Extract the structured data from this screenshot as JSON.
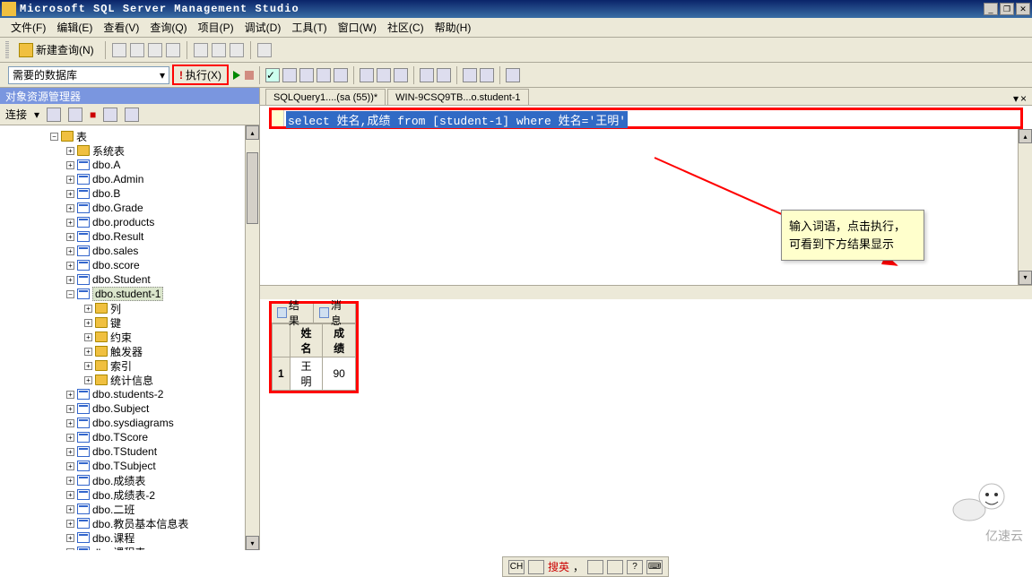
{
  "app_title": "Microsoft SQL Server Management Studio",
  "menu": {
    "file": "文件(F)",
    "edit": "编辑(E)",
    "view": "查看(V)",
    "query": "查询(Q)",
    "project": "项目(P)",
    "debug": "调试(D)",
    "tools": "工具(T)",
    "window": "窗口(W)",
    "community": "社区(C)",
    "help": "帮助(H)"
  },
  "toolbar": {
    "new_query": "新建查询(N)",
    "db_selector": "需要的数据库",
    "execute": "执行(X)"
  },
  "object_explorer": {
    "title": "对象资源管理器",
    "connect": "连接"
  },
  "tree": {
    "tables_folder": "表",
    "system_tables": "系统表",
    "cols": "列",
    "keys": "键",
    "constraints": "约束",
    "triggers": "触发器",
    "indexes": "索引",
    "stats": "统计信息",
    "tables": [
      "dbo.A",
      "dbo.Admin",
      "dbo.B",
      "dbo.Grade",
      "dbo.products",
      "dbo.Result",
      "dbo.sales",
      "dbo.score",
      "dbo.Student",
      "dbo.student-1",
      "dbo.students-2",
      "dbo.Subject",
      "dbo.sysdiagrams",
      "dbo.TScore",
      "dbo.TStudent",
      "dbo.TSubject",
      "dbo.成绩表",
      "dbo.成绩表-2",
      "dbo.二班",
      "dbo.教员基本信息表",
      "dbo.课程",
      "dbo.课程表"
    ],
    "selected": "dbo.student-1"
  },
  "docs": {
    "tab1": "SQLQuery1....(sa (55))*",
    "tab2": "WIN-9CSQ9TB...o.student-1"
  },
  "sql": "select 姓名,成绩 from [student-1] where 姓名='王明'",
  "note": "输入词语，点击执行，可看到下方结果显示",
  "results": {
    "tab_result": "结果",
    "tab_msg": "消息",
    "cols": [
      "姓名",
      "成绩"
    ],
    "row_num": "1",
    "row": [
      "王明",
      "90"
    ]
  },
  "lang": {
    "ch": "CH",
    "text": "搜英"
  },
  "watermark": "亿速云"
}
